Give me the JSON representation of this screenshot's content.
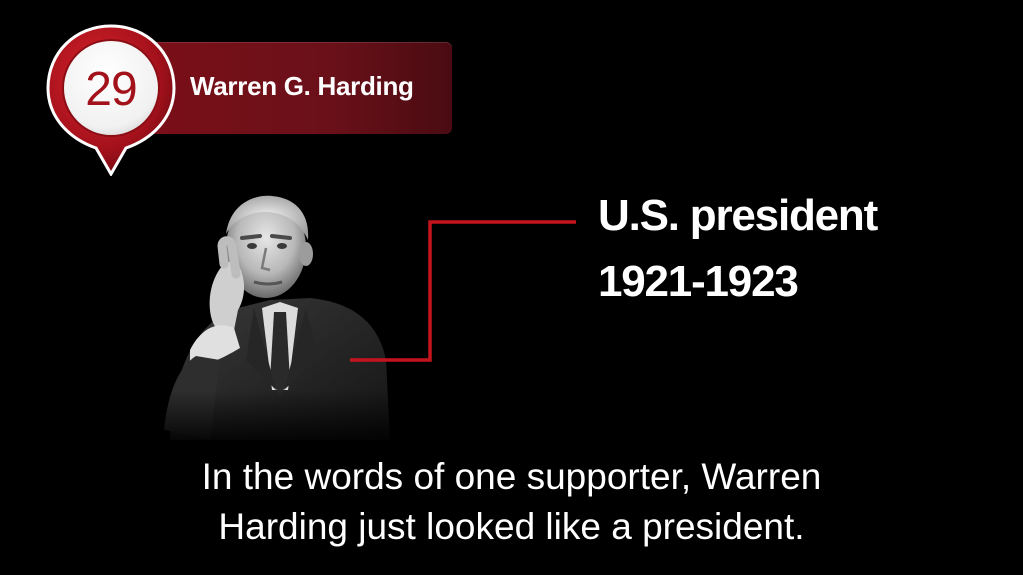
{
  "badge": {
    "number": "29",
    "name": "Warren G. Harding",
    "icon": "map-pin-icon"
  },
  "portrait": {
    "icon": "portrait-photo"
  },
  "fact": {
    "title": "U.S. president",
    "years": "1921-1923"
  },
  "caption": {
    "line1": "In the words of one supporter, Warren",
    "line2": "Harding just looked like a president."
  },
  "colors": {
    "accent": "#a3111b",
    "banner": "#6a1019",
    "connector": "#c4141c",
    "background": "#000000",
    "text": "#ffffff"
  }
}
